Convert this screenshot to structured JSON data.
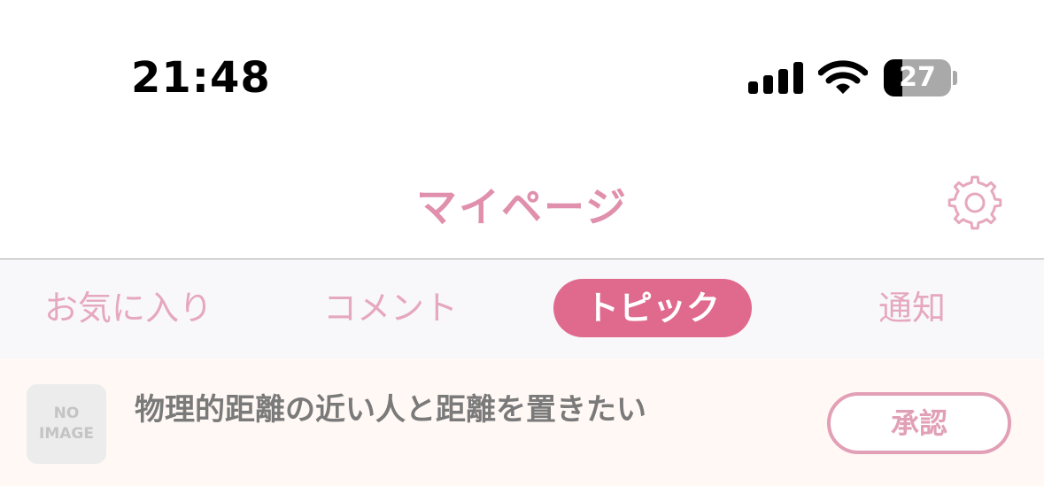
{
  "status_bar": {
    "time": "21:48",
    "battery_level": "27",
    "battery_fraction": 0.27
  },
  "header": {
    "title": "マイページ",
    "settings_icon": "gear-icon"
  },
  "tabs": [
    {
      "label": "お気に入り",
      "active": false
    },
    {
      "label": "コメント",
      "active": false
    },
    {
      "label": "トピック",
      "active": true
    },
    {
      "label": "通知",
      "active": false
    }
  ],
  "topics": [
    {
      "thumbnail_text": "NO\nIMAGE",
      "title": "物理的距離の近い人と距離を置きたい",
      "action_label": "承認"
    }
  ],
  "colors": {
    "accent": "#e06a8e",
    "accent_light": "#e6a8bd",
    "title_pink": "#e090ac",
    "list_background": "#fff8f4",
    "tab_background": "#f8f8fa"
  }
}
